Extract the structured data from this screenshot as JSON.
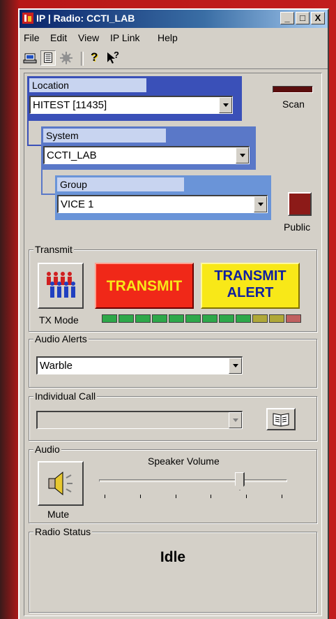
{
  "window": {
    "title": "IP | Radio: CCTI_LAB",
    "controls": [
      "_",
      "□",
      "X"
    ]
  },
  "menu": [
    "File",
    "Edit",
    "View",
    "IP Link",
    "Help"
  ],
  "toolbar": {
    "icons": [
      "radio-icon",
      "list-icon",
      "settings-icon",
      "help-icon",
      "context-help-icon"
    ],
    "help_glyph": "?",
    "context_help_glyph": "?"
  },
  "location": {
    "label": "Location",
    "value": "HITEST [11435]"
  },
  "system": {
    "label": "System",
    "value": "CCTI_LAB"
  },
  "group": {
    "label": "Group",
    "value": "VICE 1"
  },
  "scan": {
    "label": "Scan"
  },
  "public": {
    "label": "Public"
  },
  "transmit": {
    "legend": "Transmit",
    "tx_mode_label": "TX Mode",
    "transmit_label": "TRANSMIT",
    "alert_line1": "TRANSMIT",
    "alert_line2": "ALERT",
    "meter_colors": [
      "#2ea84a",
      "#2ea84a",
      "#2ea84a",
      "#2ea84a",
      "#2ea84a",
      "#2ea84a",
      "#2ea84a",
      "#2ea84a",
      "#2ea84a",
      "#b0a838",
      "#b0a838",
      "#c06060"
    ]
  },
  "audio_alerts": {
    "legend": "Audio Alerts",
    "value": "Warble"
  },
  "individual_call": {
    "legend": "Individual Call",
    "value": ""
  },
  "audio": {
    "legend": "Audio",
    "volume_label": "Speaker Volume",
    "mute_label": "Mute",
    "volume_level": 0.76
  },
  "radio_status": {
    "legend": "Radio Status",
    "value": "Idle"
  },
  "colors": {
    "transmit": "#f02818",
    "alert": "#f8e818",
    "title_bar": "#0a246a"
  }
}
